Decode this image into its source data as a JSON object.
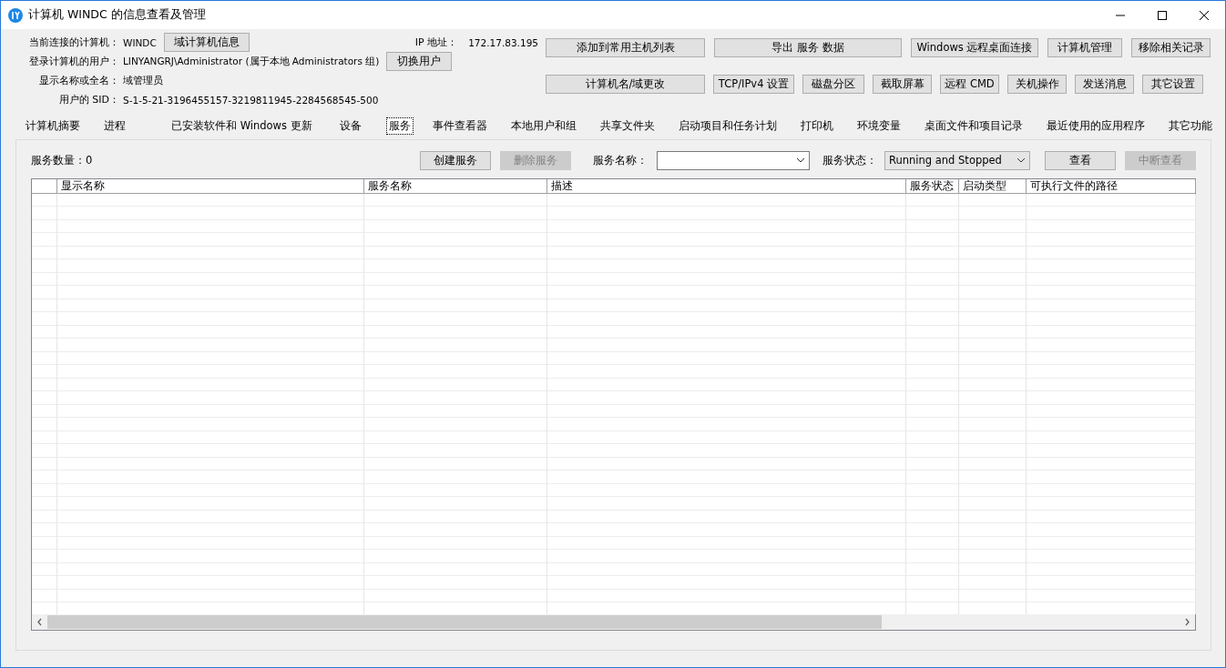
{
  "window": {
    "title": "计算机 WINDC 的信息查看及管理"
  },
  "info": {
    "rows": [
      {
        "label": "当前连接的计算机：",
        "value": "WINDC"
      },
      {
        "label": "登录计算机的用户：",
        "value": "LINYANGRJ\\Administrator (属于本地 Administrators 组)"
      },
      {
        "label": "显示名称或全名：",
        "value": "域管理员"
      },
      {
        "label": "用户的 SID：",
        "value": "S-1-5-21-3196455157-3219811945-2284568545-500"
      }
    ],
    "row_buttons": [
      "域计算机信息",
      "切换用户"
    ],
    "ip_label": "IP 地址：",
    "ip_value": "172.17.83.195"
  },
  "action_buttons": [
    [
      "添加到常用主机列表",
      "导出 服务 数据",
      "Windows 远程桌面连接",
      "计算机管理",
      "移除相关记录"
    ],
    [
      "计算机名/域更改",
      "TCP/IPv4 设置",
      "磁盘分区",
      "截取屏幕",
      "远程 CMD",
      "关机操作",
      "发送消息",
      "其它设置"
    ]
  ],
  "tabs": [
    {
      "label": "计算机摘要",
      "selected": false
    },
    {
      "label": "进程",
      "selected": false
    },
    {
      "label": "已安装软件和 Windows 更新",
      "selected": false
    },
    {
      "label": "设备",
      "selected": false
    },
    {
      "label": "服务",
      "selected": true
    },
    {
      "label": "事件查看器",
      "selected": false
    },
    {
      "label": "本地用户和组",
      "selected": false
    },
    {
      "label": "共享文件夹",
      "selected": false
    },
    {
      "label": "启动项目和任务计划",
      "selected": false
    },
    {
      "label": "打印机",
      "selected": false
    },
    {
      "label": "环境变量",
      "selected": false
    },
    {
      "label": "桌面文件和项目记录",
      "selected": false
    },
    {
      "label": "最近使用的应用程序",
      "selected": false
    },
    {
      "label": "其它功能",
      "selected": false
    }
  ],
  "services": {
    "count_label": "服务数量：0",
    "buttons": [
      {
        "label": "创建服务",
        "disabled": false
      },
      {
        "label": "删除服务",
        "disabled": true
      }
    ],
    "name_filter": {
      "label": "服务名称："
    },
    "status_filter": {
      "label": "服务状态：",
      "value": "Running and Stopped"
    },
    "view_buttons": [
      {
        "label": "查看",
        "disabled": false
      },
      {
        "label": "中断查看",
        "disabled": true
      }
    ],
    "table": {
      "columns": [
        "显示名称",
        "服务名称",
        "描述",
        "服务状态",
        "启动类型",
        "可执行文件的路径"
      ]
    }
  }
}
